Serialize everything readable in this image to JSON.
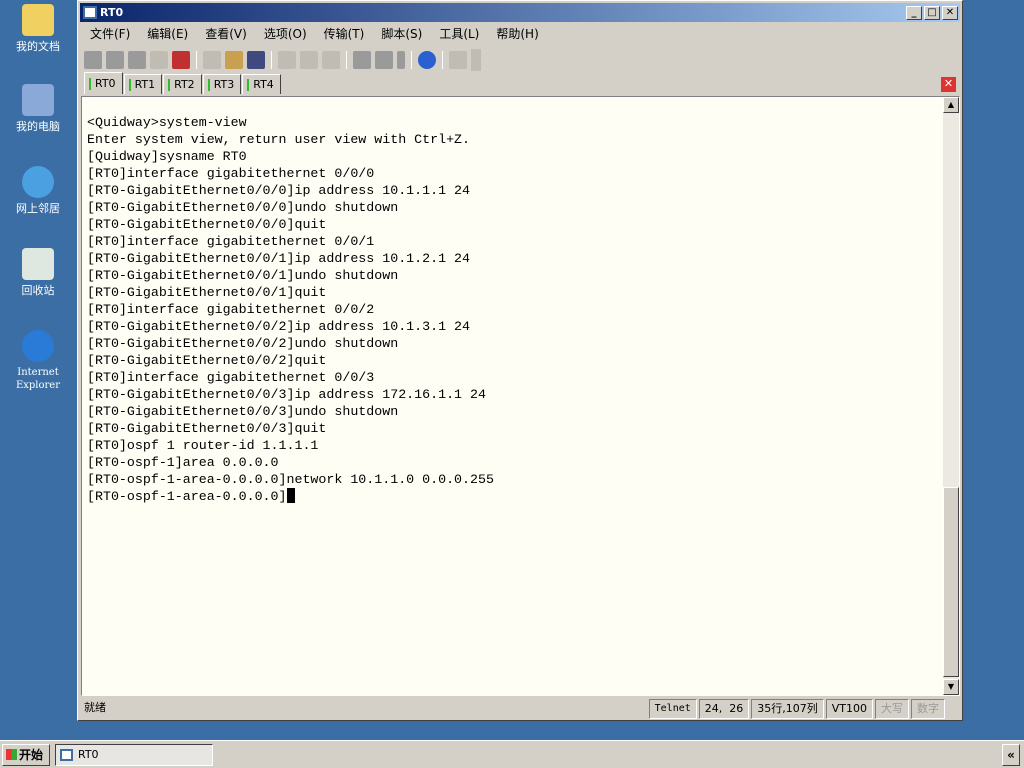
{
  "desktop": {
    "icons": [
      "我的文档",
      "我的电脑",
      "网上邻居",
      "回收站",
      "Internet Explorer"
    ]
  },
  "window": {
    "title": "RT0",
    "min": "_",
    "max": "□",
    "close": "✕"
  },
  "menu": [
    "文件(F)",
    "编辑(E)",
    "查看(V)",
    "选项(O)",
    "传输(T)",
    "脚本(S)",
    "工具(L)",
    "帮助(H)"
  ],
  "tabs": [
    "RT0",
    "RT1",
    "RT2",
    "RT3",
    "RT4"
  ],
  "tab_close": "✕",
  "terminal": {
    "lines": [
      "<Quidway>system-view",
      "Enter system view, return user view with Ctrl+Z.",
      "[Quidway]sysname RT0",
      "[RT0]interface gigabitethernet 0/0/0",
      "[RT0-GigabitEthernet0/0/0]ip address 10.1.1.1 24",
      "[RT0-GigabitEthernet0/0/0]undo shutdown",
      "[RT0-GigabitEthernet0/0/0]quit",
      "[RT0]interface gigabitethernet 0/0/1",
      "[RT0-GigabitEthernet0/0/1]ip address 10.1.2.1 24",
      "[RT0-GigabitEthernet0/0/1]undo shutdown",
      "[RT0-GigabitEthernet0/0/1]quit",
      "[RT0]interface gigabitethernet 0/0/2",
      "[RT0-GigabitEthernet0/0/2]ip address 10.1.3.1 24",
      "[RT0-GigabitEthernet0/0/2]undo shutdown",
      "[RT0-GigabitEthernet0/0/2]quit",
      "[RT0]interface gigabitethernet 0/0/3",
      "[RT0-GigabitEthernet0/0/3]ip address 172.16.1.1 24",
      "[RT0-GigabitEthernet0/0/3]undo shutdown",
      "[RT0-GigabitEthernet0/0/3]quit",
      "[RT0]ospf 1 router-id 1.1.1.1",
      "[RT0-ospf-1]area 0.0.0.0",
      "[RT0-ospf-1-area-0.0.0.0]network 10.1.1.0 0.0.0.255"
    ],
    "prompt": "[RT0-ospf-1-area-0.0.0.0]"
  },
  "status": {
    "ready": "就绪",
    "protocol": "Telnet",
    "cursor": "24,  26",
    "size": "35行,107列",
    "emulation": "VT100",
    "caps": "大写",
    "num": "数字"
  },
  "taskbar": {
    "start": "开始",
    "task": "RT0",
    "tray_toggle": "«"
  }
}
